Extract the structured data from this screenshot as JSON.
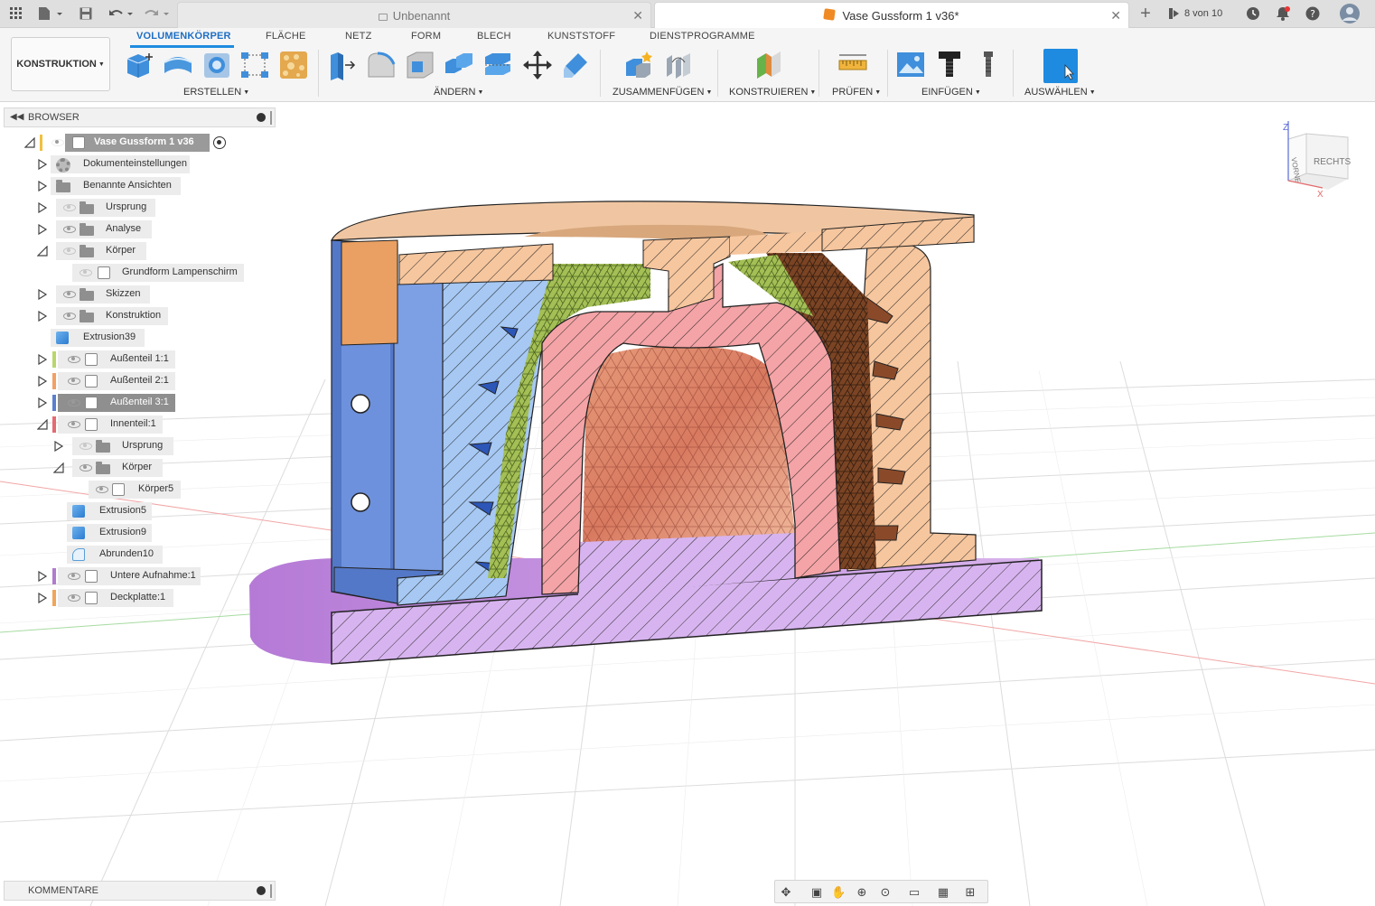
{
  "titlebar": {
    "tabs": [
      {
        "label": "Unbenannt",
        "active": false
      },
      {
        "label": "Vase Gussform 1 v36*",
        "active": true
      }
    ],
    "job_count": "8 von 10"
  },
  "toolbar": {
    "workspace": "KONSTRUKTION",
    "ribbon_tabs": [
      "VOLUMENKÖRPER",
      "FLÄCHE",
      "NETZ",
      "FORM",
      "BLECH",
      "KUNSTSTOFF",
      "DIENSTPROGRAMME"
    ],
    "groups": {
      "erstellen": "ERSTELLEN",
      "aendern": "ÄNDERN",
      "zusammenfuegen": "ZUSAMMENFÜGEN",
      "konstruieren": "KONSTRUIEREN",
      "pruefen": "PRÜFEN",
      "einfuegen": "EINFÜGEN",
      "auswaehlen": "AUSWÄHLEN"
    }
  },
  "browser": {
    "title": "BROWSER",
    "items": [
      {
        "label": "Vase Gussform 1 v36"
      },
      {
        "label": "Dokumenteinstellungen"
      },
      {
        "label": "Benannte Ansichten"
      },
      {
        "label": "Ursprung"
      },
      {
        "label": "Analyse"
      },
      {
        "label": "Körper"
      },
      {
        "label": "Grundform Lampenschirm"
      },
      {
        "label": "Skizzen"
      },
      {
        "label": "Konstruktion"
      },
      {
        "label": "Extrusion39"
      },
      {
        "label": "Außenteil 1:1"
      },
      {
        "label": "Außenteil 2:1"
      },
      {
        "label": "Außenteil 3:1"
      },
      {
        "label": "Innenteil:1"
      },
      {
        "label": "Ursprung"
      },
      {
        "label": "Körper"
      },
      {
        "label": "Körper5"
      },
      {
        "label": "Extrusion5"
      },
      {
        "label": "Extrusion9"
      },
      {
        "label": "Abrunden10"
      },
      {
        "label": "Untere Aufnahme:1"
      },
      {
        "label": "Deckplatte:1"
      }
    ]
  },
  "comments": {
    "title": "KOMMENTARE"
  },
  "viewcube": {
    "front": "VORNE",
    "right": "RECHTS",
    "z": "Z",
    "x": "X"
  },
  "colors": {
    "accent": "#1f8be0",
    "green_part": "#b9cc6a",
    "orange_part": "#f2a066",
    "blue_part": "#5b7fd0",
    "red_part": "#e56a72",
    "purple_part": "#b07ccf",
    "yellow_part": "#f0c040"
  }
}
